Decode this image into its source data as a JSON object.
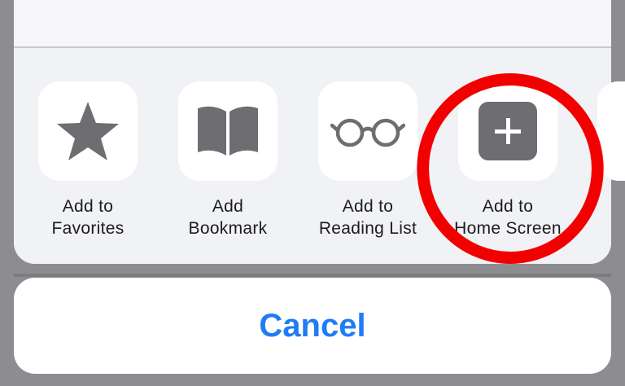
{
  "share_actions": [
    {
      "id": "favorites",
      "label_line1": "Add to",
      "label_line2": "Favorites",
      "icon": "star-icon"
    },
    {
      "id": "bookmark",
      "label_line1": "Add",
      "label_line2": "Bookmark",
      "icon": "book-icon"
    },
    {
      "id": "reading-list",
      "label_line1": "Add to",
      "label_line2": "Reading List",
      "icon": "glasses-icon"
    },
    {
      "id": "home-screen",
      "label_line1": "Add to",
      "label_line2": "Home Screen",
      "icon": "plus-square-icon"
    }
  ],
  "cancel_label": "Cancel",
  "colors": {
    "icon_gray": "#6d6d72",
    "cancel_blue": "#1f7cf4",
    "annotation_red": "#f20000",
    "sheet_bg": "#f1f2f5",
    "overlay_gray": "#8d8d91"
  }
}
